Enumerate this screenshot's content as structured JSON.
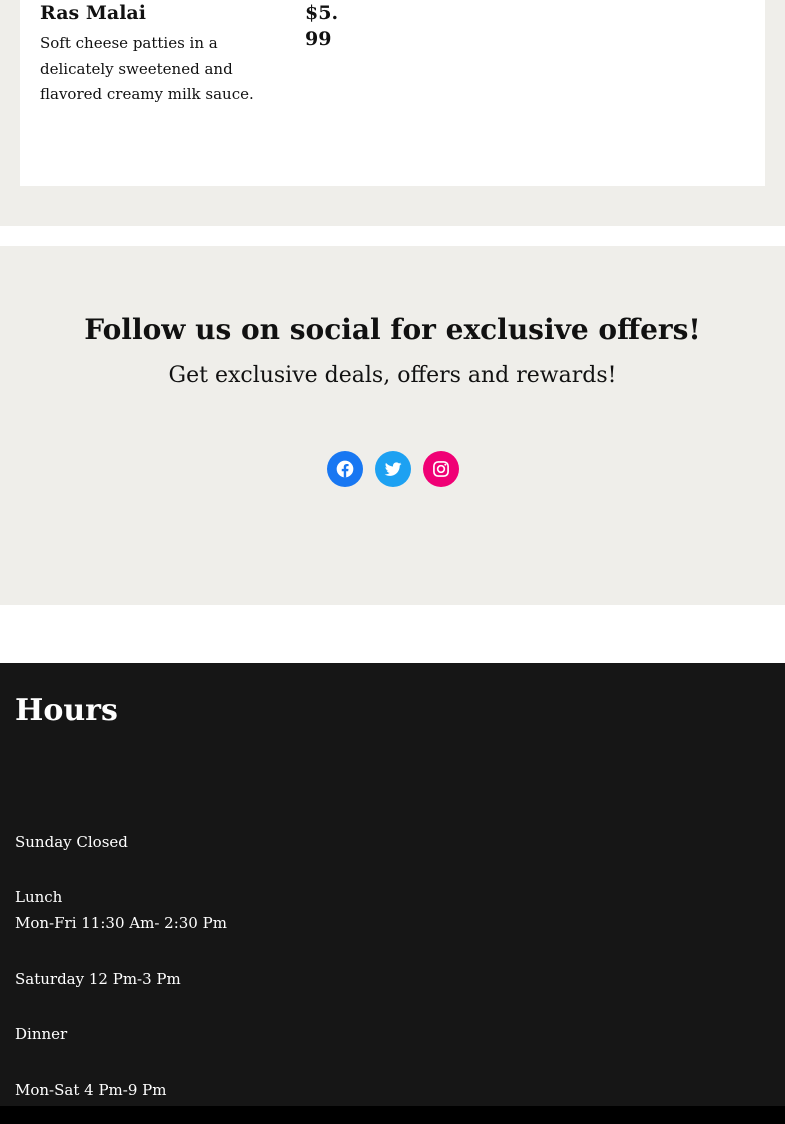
{
  "menu": {
    "item": {
      "name": "Ras Malai",
      "description": "Soft cheese patties in a delicately sweetened and flavored creamy milk sauce.",
      "price": "$5.99"
    }
  },
  "social": {
    "heading": "Follow us on social for exclusive offers!",
    "subheading": "Get exclusive deals, offers and rewards!",
    "links": [
      {
        "name": "Facebook",
        "icon": "facebook-icon",
        "color": "#1877f2"
      },
      {
        "name": "Twitter",
        "icon": "twitter-icon",
        "color": "#1da1f2"
      },
      {
        "name": "Instagram",
        "icon": "instagram-icon",
        "color": "#f00075"
      }
    ]
  },
  "hours": {
    "title": "Hours",
    "sunday": "Sunday Closed",
    "lunch_label": "Lunch",
    "lunch_weekdays": "Mon-Fri 11:30 Am- 2:30 Pm",
    "saturday": "Saturday 12 Pm-3 Pm",
    "dinner_label": "Dinner",
    "dinner_hours": "Mon-Sat 4 Pm-9 Pm"
  },
  "colors": {
    "section_background": "#efeeea",
    "hours_background": "#161616",
    "text": "#111111"
  }
}
